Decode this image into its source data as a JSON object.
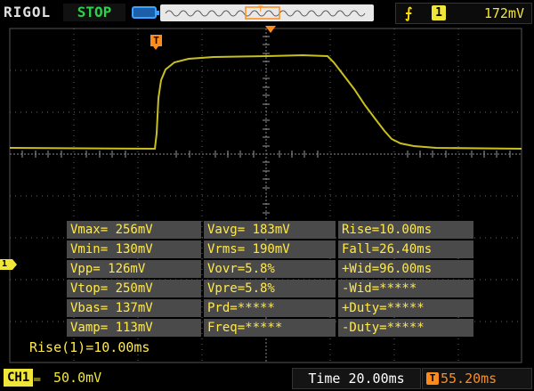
{
  "topbar": {
    "brand": "RIGOL",
    "run_state": "STOP",
    "trigger": {
      "source": "1",
      "level": "172mV",
      "edge_icon": "rising-edge-icon"
    }
  },
  "markers": {
    "trigger_marker": "T",
    "channel_marker": "1"
  },
  "measurements": [
    [
      "Vmax= 256mV",
      "Vavg= 183mV",
      "Rise=10.00ms"
    ],
    [
      "Vmin= 130mV",
      "Vrms= 190mV",
      "Fall=26.40ms"
    ],
    [
      "Vpp= 126mV",
      "Vovr=5.8%",
      "+Wid=96.00ms"
    ],
    [
      "Vtop= 250mV",
      "Vpre=5.8%",
      "-Wid=*****"
    ],
    [
      "Vbas= 137mV",
      "Prd=*****",
      "+Duty=*****"
    ],
    [
      "Vamp= 113mV",
      "Freq=*****",
      "-Duty=*****"
    ]
  ],
  "rise_readout": "Rise(1)=10.00ms",
  "bottombar": {
    "channel": "CH1",
    "coupling_icon": "dc-coupling-icon",
    "vscale": "50.0mV",
    "timebase": "Time 20.00ms",
    "trigger_offset_icon": "T",
    "trigger_offset": "55.20ms"
  },
  "colors": {
    "trace": "#c8c020",
    "text": "#ffe94a",
    "accent": "#ff8c1a",
    "grid": "#666666"
  }
}
